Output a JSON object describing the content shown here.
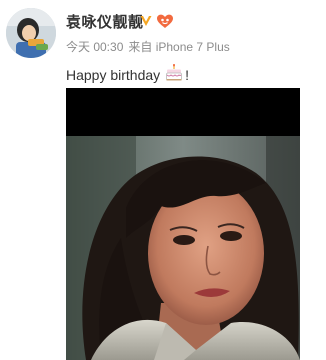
{
  "post": {
    "author": {
      "name": "袁咏仪靓靓",
      "avatar_icon": "avatar-cartoon-icon"
    },
    "badges": [
      {
        "icon": "verified-v-icon",
        "color": "#f5a623"
      },
      {
        "icon": "fan-club-icon",
        "color": "#f26a3f"
      }
    ],
    "meta": {
      "time": "今天 00:30",
      "source": "来自 iPhone 7 Plus"
    },
    "content": {
      "text": "Happy birthday",
      "emoji_icon": "birthday-cake-icon",
      "suffix": "!"
    },
    "image": {
      "icon": "portrait-photo"
    }
  },
  "colors": {
    "text": "#333333",
    "meta": "#8c8c8c",
    "verified": "#f5a623"
  }
}
